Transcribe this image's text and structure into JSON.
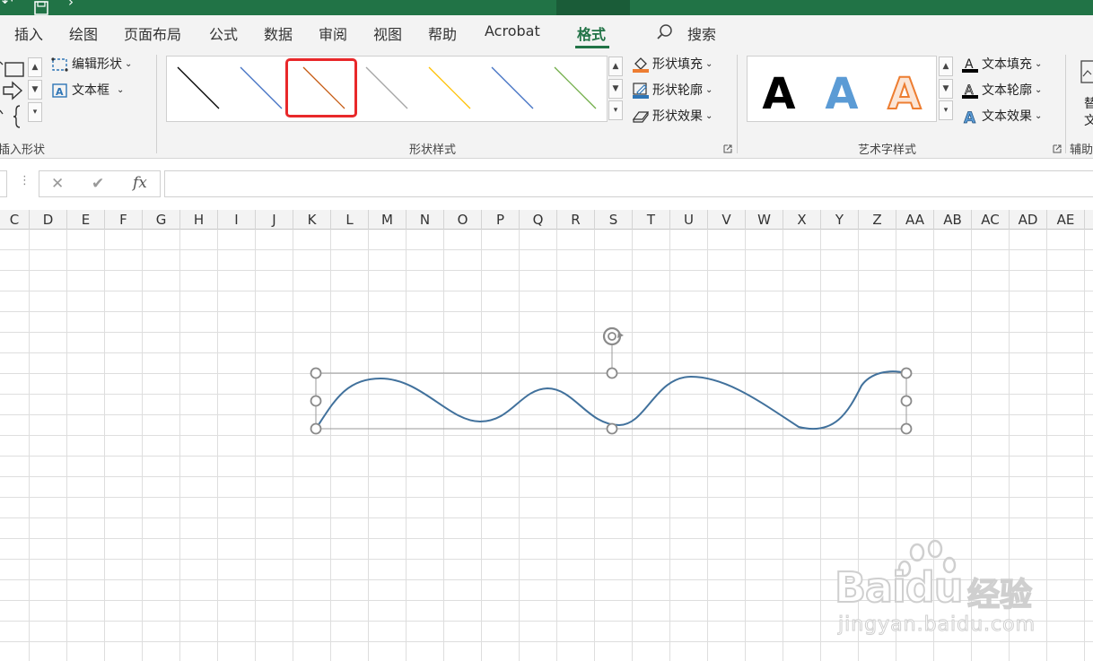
{
  "ribbon_tabs": [
    {
      "label": "插入",
      "active": false
    },
    {
      "label": "绘图",
      "active": false
    },
    {
      "label": "页面布局",
      "active": false
    },
    {
      "label": "公式",
      "active": false
    },
    {
      "label": "数据",
      "active": false
    },
    {
      "label": "审阅",
      "active": false
    },
    {
      "label": "视图",
      "active": false
    },
    {
      "label": "帮助",
      "active": false
    },
    {
      "label": "Acrobat",
      "active": false
    },
    {
      "label": "格式",
      "active": true
    }
  ],
  "search": {
    "label": "搜索"
  },
  "groups": {
    "insert_shapes": {
      "label": "插入形状",
      "edit_shape": "编辑形状",
      "text_box": "文本框"
    },
    "shape_styles": {
      "label": "形状样式",
      "fill": "形状填充",
      "outline": "形状轮廓",
      "effects": "形状效果",
      "line_colors": [
        "#000000",
        "#4472c4",
        "#c55a11",
        "#a5a5a5",
        "#ffc000",
        "#4472c4",
        "#70ad47"
      ],
      "selected_index": 2
    },
    "wordart_styles": {
      "label": "艺术字样式",
      "samples": [
        "A",
        "A",
        "A"
      ],
      "text_fill": "文本填充",
      "text_outline": "文本轮廓",
      "text_effects": "文本效果"
    },
    "accessibility": {
      "label": "辅助",
      "partial": "替",
      "partial2": "文"
    }
  },
  "formula_bar": {
    "cancel_glyph": "✕",
    "enter_glyph": "✔",
    "fx_label": "fx",
    "value": ""
  },
  "columns": [
    "C",
    "D",
    "E",
    "F",
    "G",
    "H",
    "I",
    "J",
    "K",
    "L",
    "M",
    "N",
    "O",
    "P",
    "Q",
    "R",
    "S",
    "T",
    "U",
    "V",
    "W",
    "X",
    "Y",
    "Z",
    "AA",
    "AB",
    "AC",
    "AD",
    "AE"
  ],
  "shape": {
    "type": "wave-curve",
    "stroke": "#41719c"
  },
  "watermark": {
    "brand": "Baidu",
    "cn": "经验",
    "url": "jingyan.baidu.com"
  },
  "colors": {
    "accent": "#217346",
    "highlight": "#e8282a"
  }
}
